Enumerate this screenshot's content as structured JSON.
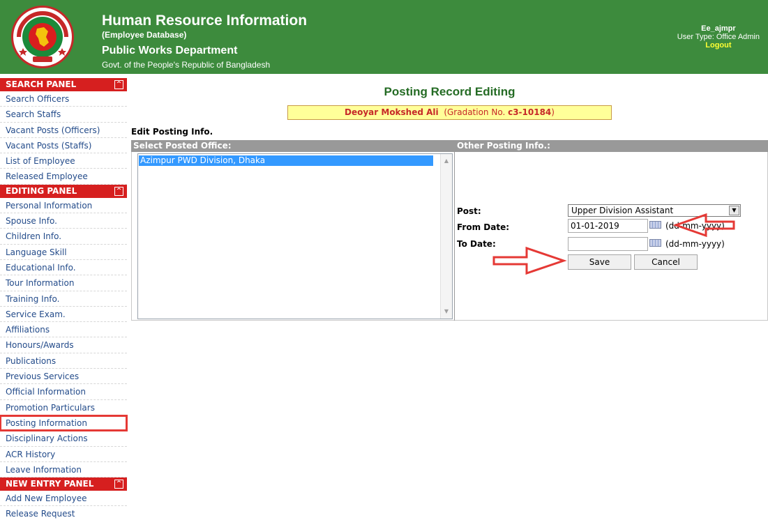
{
  "header": {
    "title": "Human Resource Information",
    "subtitle": "(Employee Database)",
    "department": "Public Works Department",
    "govt": "Govt. of the People's Republic of Bangladesh",
    "user_name": "Ee_ajmpr",
    "user_type": "User Type: Office Admin",
    "logout": "Logout"
  },
  "sidebar": {
    "search_panel": {
      "title": "SEARCH PANEL",
      "items": [
        "Search Officers",
        "Search Staffs",
        "Vacant Posts (Officers)",
        "Vacant Posts (Staffs)",
        "List of Employee",
        "Released Employee"
      ]
    },
    "editing_panel": {
      "title": "EDITING PANEL",
      "items": [
        "Personal Information",
        "Spouse Info.",
        "Children Info.",
        "Language Skill",
        "Educational Info.",
        "Tour Information",
        "Training Info.",
        "Service Exam.",
        "Affiliations",
        "Honours/Awards",
        "Publications",
        "Previous Services",
        "Official Information",
        "Promotion Particulars",
        "Posting Information",
        "Disciplinary Actions",
        "ACR History",
        "Leave Information"
      ]
    },
    "new_entry_panel": {
      "title": "NEW ENTRY PANEL",
      "items": [
        "Add New Employee",
        "Release Request"
      ]
    },
    "toggle_symbol": "^"
  },
  "main": {
    "page_title": "Posting Record Editing",
    "employee": {
      "name": "Deoyar Mokshed Ali",
      "gradation_prefix": "(Gradation No. ",
      "gradation_no": "c3-10184",
      "gradation_suffix": ")"
    },
    "section_title": "Edit Posting Info.",
    "col_left": "Select Posted Office:",
    "col_right": "Other Posting Info.:",
    "offices": [
      "Azimpur PWD Division, Dhaka"
    ],
    "form": {
      "post_label": "Post:",
      "post_value": "Upper Division Assistant",
      "from_label": "From Date:",
      "from_value": "01-01-2019",
      "to_label": "To Date:",
      "to_value": "",
      "date_format": "(dd-mm-yyyy)",
      "save": "Save",
      "cancel": "Cancel"
    }
  },
  "colors": {
    "header_green": "#3d8b3d",
    "panel_red": "#d61f1f",
    "link_blue": "#234b8a",
    "title_green": "#246b24",
    "highlight_yellow": "#ffff99",
    "annotation_red": "#e53935"
  }
}
